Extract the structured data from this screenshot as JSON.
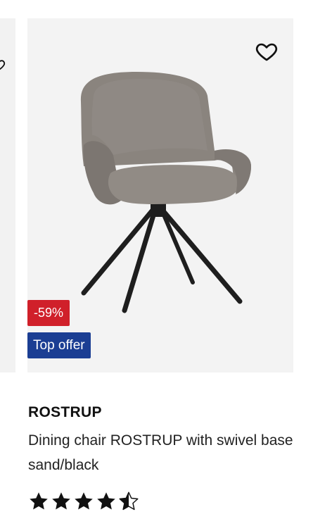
{
  "product": {
    "brand": "ROSTRUP",
    "description": "Dining chair ROSTRUP with swivel base sand/black",
    "discount": "-59%",
    "badge": "Top offer",
    "rating": 4.5,
    "rating_max": 5,
    "image_icon": "chair-image"
  },
  "icons": {
    "wishlist": "heart-outline-icon",
    "star": "star-icon"
  },
  "colors": {
    "discount_bg": "#d0202a",
    "offer_bg": "#1b3e93",
    "card_bg": "#f3f3f3",
    "chair_fabric": "#8a847e",
    "chair_legs": "#1e1e1e"
  }
}
